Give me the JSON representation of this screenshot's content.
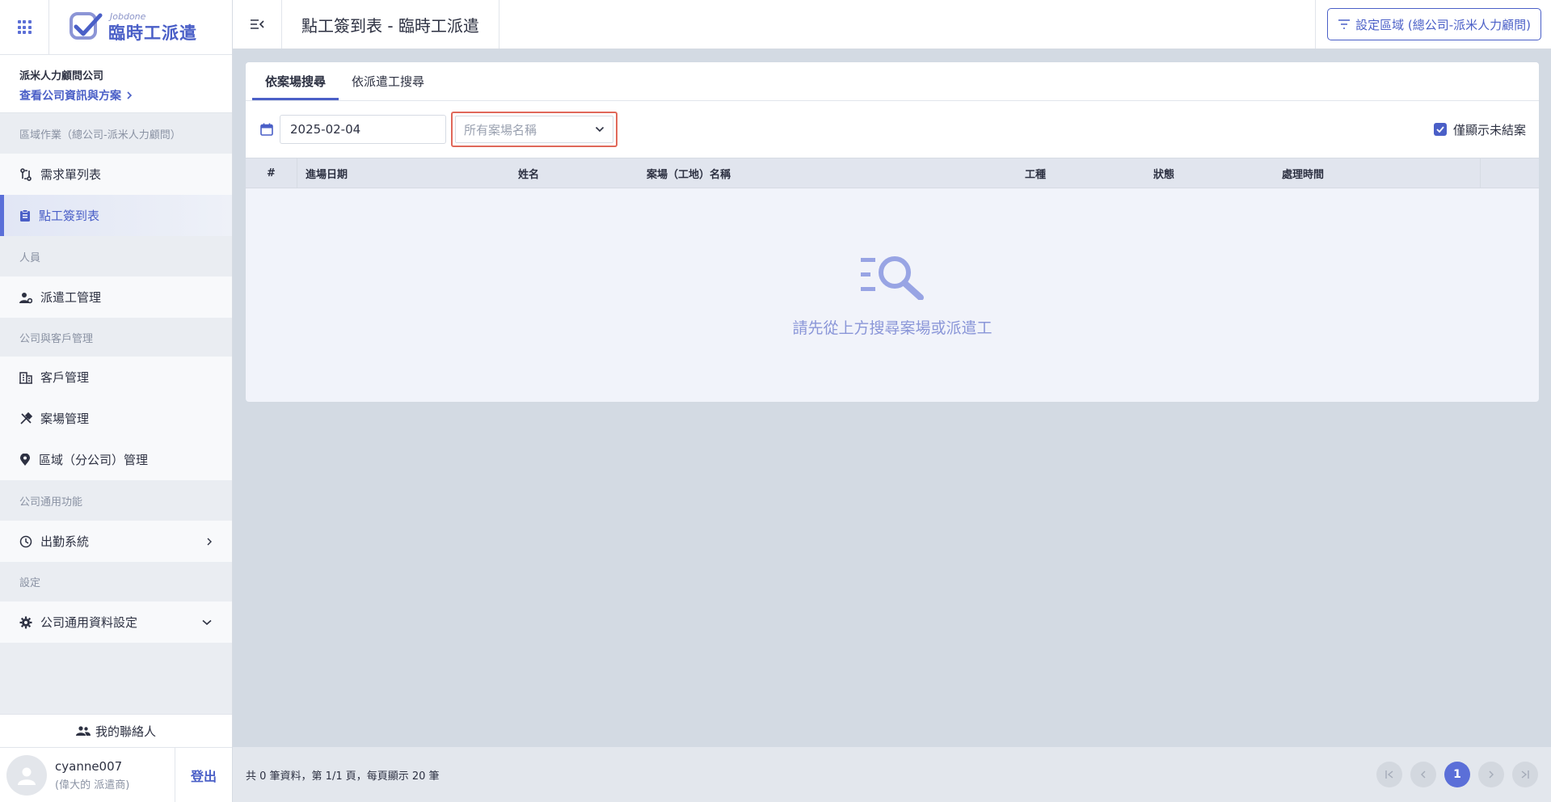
{
  "app": {
    "logo_small": "Jobdone",
    "logo_big": "臨時工派遣"
  },
  "company": {
    "name": "派米人力顧問公司",
    "link": "查看公司資訊與方案"
  },
  "sidebar": {
    "sections": [
      {
        "label": "區域作業（總公司-派米人力顧問）",
        "items": [
          {
            "label": "需求單列表",
            "icon": "route-icon"
          },
          {
            "label": "點工簽到表",
            "icon": "clipboard-icon",
            "active": true
          }
        ]
      },
      {
        "label": "人員",
        "items": [
          {
            "label": "派遣工管理",
            "icon": "worker-gear-icon"
          }
        ]
      },
      {
        "label": "公司與客戶管理",
        "items": [
          {
            "label": "客戶管理",
            "icon": "building-icon"
          },
          {
            "label": "案場管理",
            "icon": "tools-icon"
          },
          {
            "label": "區域（分公司）管理",
            "icon": "location-pin-icon"
          }
        ]
      },
      {
        "label": "公司通用功能",
        "items": [
          {
            "label": "出勤系統",
            "icon": "clock-icon"
          }
        ]
      },
      {
        "label": "設定",
        "items": [
          {
            "label": "公司通用資料設定",
            "icon": "gear-icon"
          }
        ]
      }
    ],
    "contacts": "我的聯絡人",
    "user": {
      "name": "cyanne007",
      "role": "(偉大的 派遣商)",
      "logout": "登出"
    }
  },
  "header": {
    "title": "點工簽到表 - 臨時工派遣",
    "region_button": "設定區域 (總公司-派米人力顧問)"
  },
  "tabs": [
    {
      "label": "依案場搜尋",
      "active": true
    },
    {
      "label": "依派遣工搜尋",
      "active": false
    }
  ],
  "filters": {
    "date": "2025-02-04",
    "site_placeholder": "所有案場名稱",
    "only_open_label": "僅顯示未結案",
    "only_open_checked": true
  },
  "table": {
    "columns": [
      "#",
      "進場日期",
      "姓名",
      "案場（工地）名稱",
      "工種",
      "狀態",
      "處理時間"
    ],
    "rows": [],
    "empty_text": "請先從上方搜尋案場或派遣工"
  },
  "footer": {
    "summary": "共 0 筆資料，第 1/1 頁，每頁顯示 20 筆",
    "current_page": "1"
  },
  "colors": {
    "accent": "#4a5fc7",
    "highlight_border": "#e0685a"
  }
}
